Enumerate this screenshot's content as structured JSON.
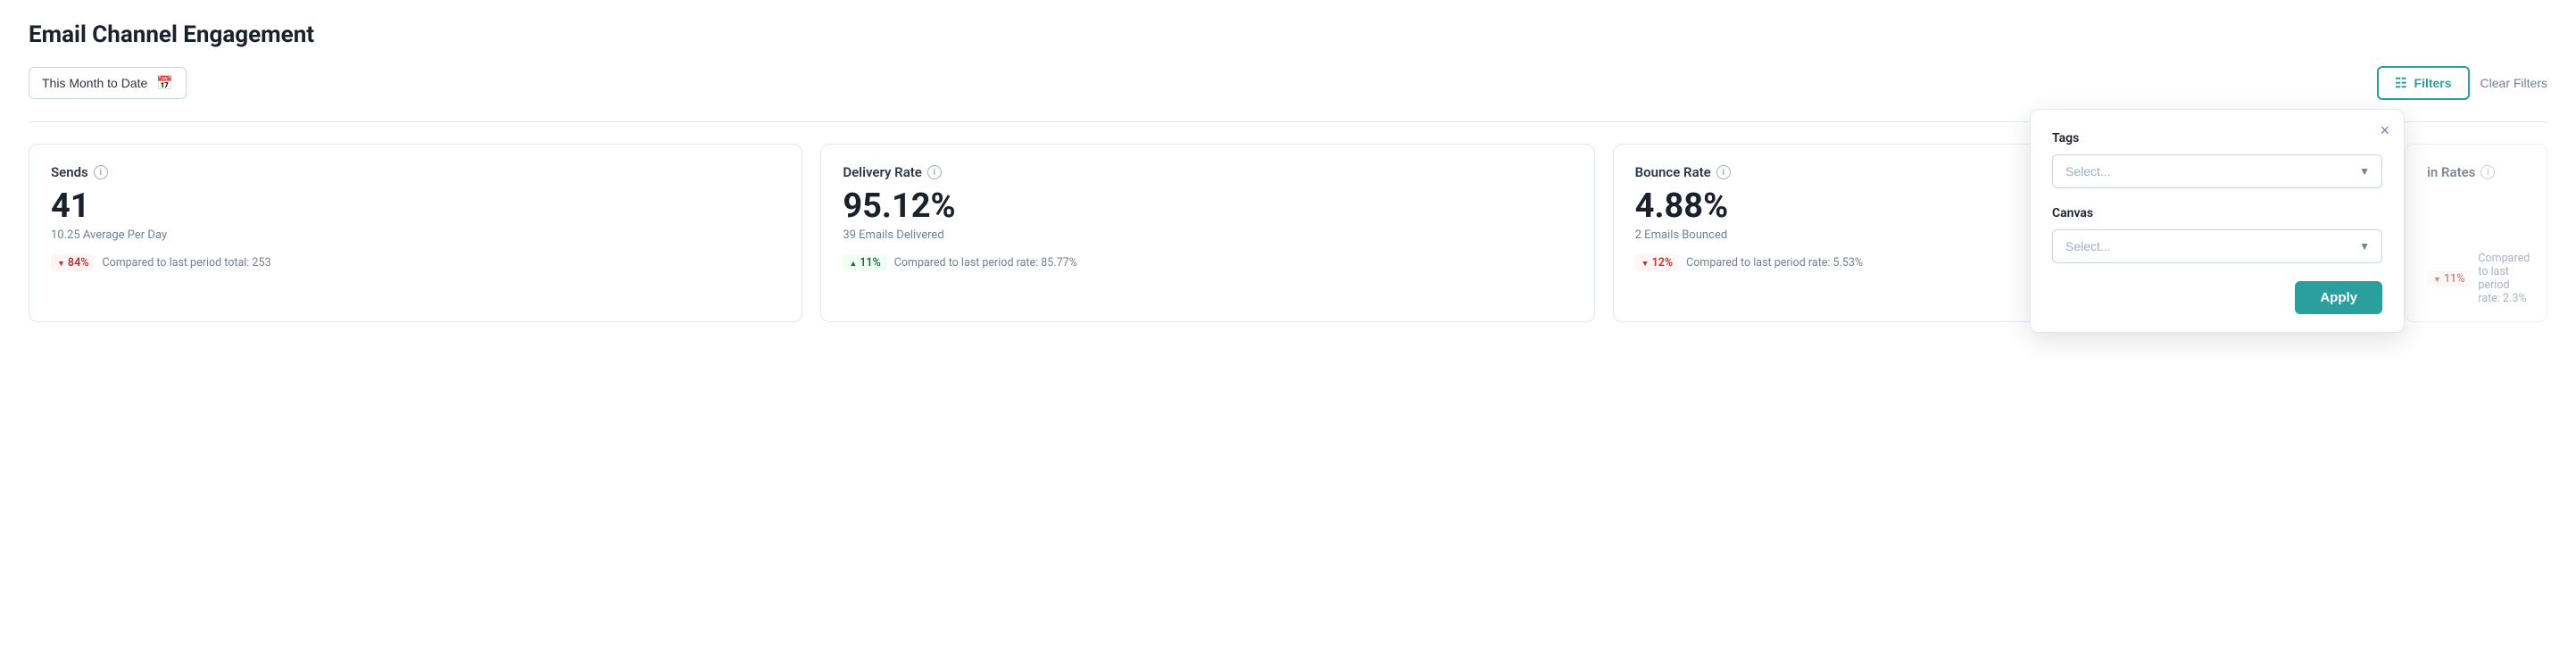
{
  "page": {
    "title": "Email Channel Engagement"
  },
  "topbar": {
    "date_label": "This Month to Date",
    "filters_label": "Filters",
    "clear_filters_label": "Clear Filters"
  },
  "filter_panel": {
    "tags_label": "Tags",
    "tags_placeholder": "Select...",
    "canvas_label": "Canvas",
    "canvas_placeholder": "Select...",
    "apply_label": "Apply",
    "close_label": "×"
  },
  "metrics": [
    {
      "label": "Sends",
      "value": "41",
      "sub": "10.25 Average Per Day",
      "badge_direction": "down",
      "badge_value": "84%",
      "comparison": "Compared to last period total: 253"
    },
    {
      "label": "Delivery Rate",
      "value": "95.12%",
      "sub": "39 Emails Delivered",
      "badge_direction": "up",
      "badge_value": "11%",
      "comparison": "Compared to last period rate: 85.77%"
    },
    {
      "label": "Bounce Rate",
      "value": "4.88%",
      "sub": "2 Emails Bounced",
      "badge_direction": "down",
      "badge_value": "12%",
      "comparison": "Compared to last period rate: 5.53%"
    }
  ],
  "partial_card": {
    "label": "in Rates",
    "badge_value": "11%",
    "comparison": "Compared to last period rate: 2.3%"
  }
}
